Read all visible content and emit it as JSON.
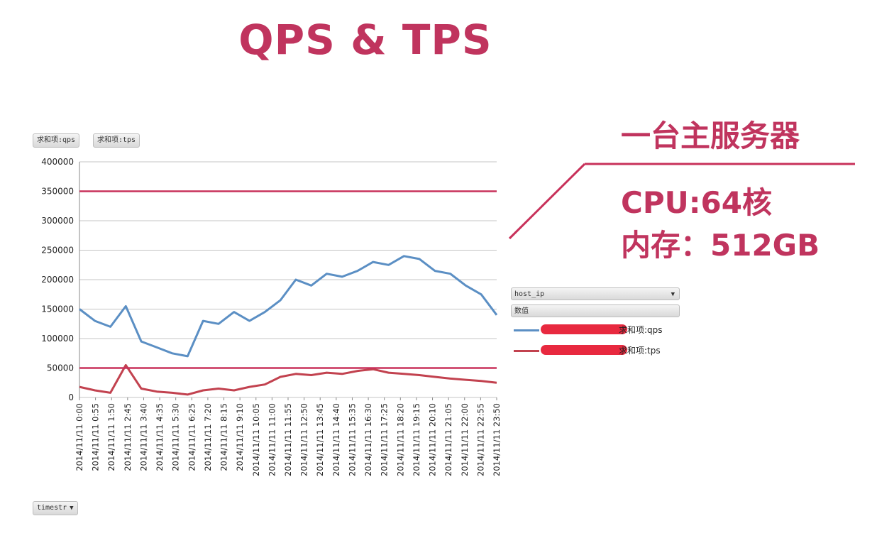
{
  "title": "QPS & TPS",
  "annotations": {
    "server": "一台主服务器",
    "cpu": "CPU:64核",
    "memory": "内存：512GB"
  },
  "controls": {
    "field_qps": "求和项:qps",
    "field_tps": "求和项:tps",
    "axis_field": "timestr",
    "legend_field": "host_ip",
    "legend_values": "数值"
  },
  "colors": {
    "accent": "#c0345e",
    "qps": "#5b8fc4",
    "tps": "#c2424f",
    "reference": "#c8315a",
    "redaction": "#e8293f"
  },
  "chart_data": {
    "type": "line",
    "yticks": [
      "0",
      "50000",
      "100000",
      "150000",
      "200000",
      "250000",
      "300000",
      "350000",
      "400000"
    ],
    "ylim": [
      0,
      400000
    ],
    "grid": true,
    "legend_position": "right",
    "x": [
      "2014/11/11 0:00",
      "2014/11/11 0:55",
      "2014/11/11 1:50",
      "2014/11/11 2:45",
      "2014/11/11 3:40",
      "2014/11/11 4:35",
      "2014/11/11 5:30",
      "2014/11/11 6:25",
      "2014/11/11 7:20",
      "2014/11/11 8:15",
      "2014/11/11 9:10",
      "2014/11/11 10:05",
      "2014/11/11 11:00",
      "2014/11/11 11:55",
      "2014/11/11 12:50",
      "2014/11/11 13:45",
      "2014/11/11 14:40",
      "2014/11/11 15:35",
      "2014/11/11 16:30",
      "2014/11/11 17:25",
      "2014/11/11 18:20",
      "2014/11/11 19:15",
      "2014/11/11 20:10",
      "2014/11/11 21:05",
      "2014/11/11 22:00",
      "2014/11/11 22:55",
      "2014/11/11 23:50"
    ],
    "reference_lines": [
      350000,
      50000
    ],
    "series": [
      {
        "name": "求和项:qps",
        "values": [
          150000,
          130000,
          120000,
          155000,
          95000,
          85000,
          75000,
          70000,
          130000,
          125000,
          145000,
          130000,
          145000,
          165000,
          200000,
          190000,
          210000,
          205000,
          215000,
          230000,
          225000,
          240000,
          235000,
          215000,
          210000,
          190000,
          175000,
          140000
        ]
      },
      {
        "name": "求和项:tps",
        "values": [
          18000,
          12000,
          8000,
          55000,
          15000,
          10000,
          8000,
          5000,
          12000,
          15000,
          12000,
          18000,
          22000,
          35000,
          40000,
          38000,
          42000,
          40000,
          45000,
          48000,
          42000,
          40000,
          38000,
          35000,
          32000,
          30000,
          28000,
          25000
        ]
      }
    ]
  }
}
